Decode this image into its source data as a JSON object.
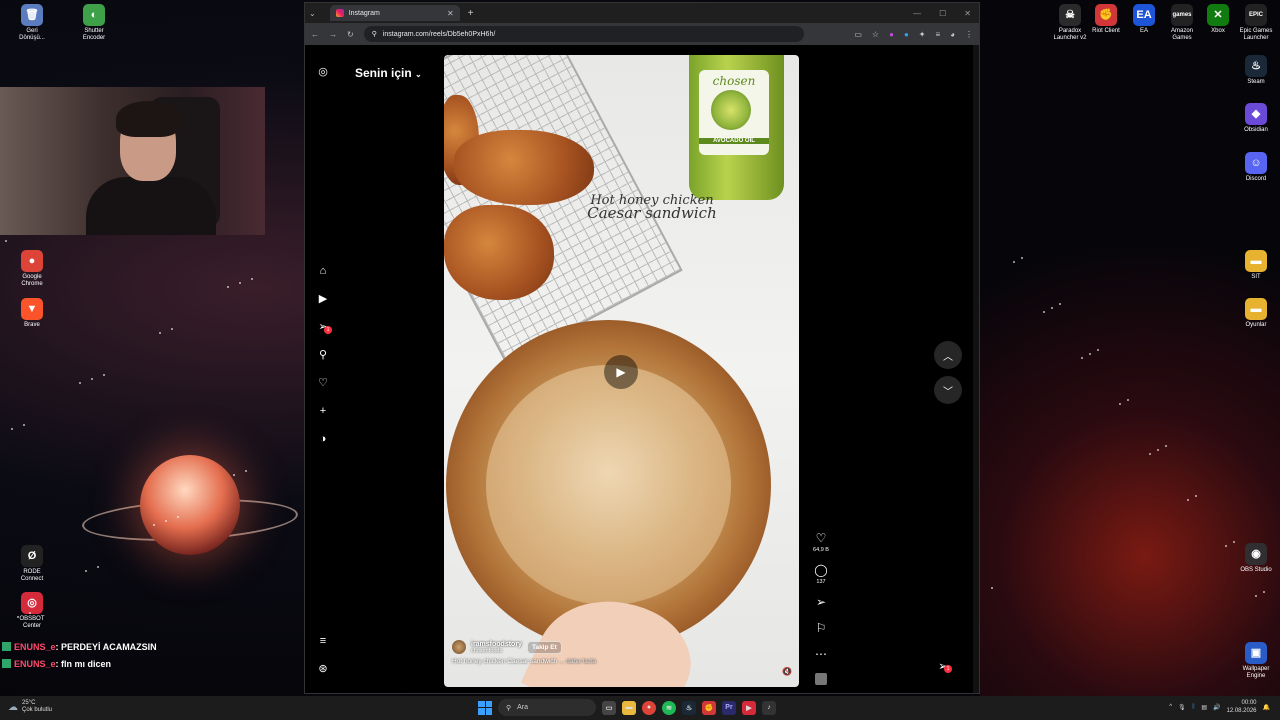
{
  "desktop_left": {
    "icons": [
      {
        "label": "Geri\nDönüşü...",
        "glyph": "🗑",
        "color": "#5b7dbf"
      },
      {
        "label": "Shutter\nEncoder",
        "glyph": "◐",
        "color": "#3fa04a"
      },
      {
        "label": "Google\nChrome",
        "glyph": "●",
        "color": "#db4437"
      },
      {
        "label": "Brave",
        "glyph": "▼",
        "color": "#fb542b"
      },
      {
        "label": "RODE\nConnect",
        "glyph": "Ø",
        "color": "#222"
      },
      {
        "label": "OBSBOT\nCenter",
        "glyph": "◎",
        "color": "#d42a3a"
      }
    ]
  },
  "desktop_right": {
    "icons": [
      {
        "label": "Paradox\nLauncher v2",
        "glyph": "☠",
        "color": "#2a2a2a"
      },
      {
        "label": "Riot Client",
        "glyph": "✊",
        "color": "#d13639"
      },
      {
        "label": "EA",
        "glyph": "EA",
        "color": "#1e55d8"
      },
      {
        "label": "Amazon\nGames",
        "glyph": "games",
        "color": "#222"
      },
      {
        "label": "Xbox",
        "glyph": "✕",
        "color": "#107c10"
      },
      {
        "label": "Epic Games\nLauncher",
        "glyph": "EPIC",
        "color": "#222"
      },
      {
        "label": "Steam",
        "glyph": "♨",
        "color": "#1b2838"
      },
      {
        "label": "Obsidian",
        "glyph": "◆",
        "color": "#6c4ad8"
      },
      {
        "label": "Discord",
        "glyph": "☺",
        "color": "#5865f2"
      },
      {
        "label": "SIT",
        "glyph": "▬",
        "color": "#e6b230"
      },
      {
        "label": "Oyunlar",
        "glyph": "▬",
        "color": "#e6b230"
      },
      {
        "label": "OBS Studio",
        "glyph": "◉",
        "color": "#302e31"
      },
      {
        "label": "Wallpaper\nEngine",
        "glyph": "▣",
        "color": "#2a5cc8"
      }
    ]
  },
  "chat": [
    {
      "user": "ENUNS_e",
      "message": ": PERDEYİ ACAMAZSIN"
    },
    {
      "user": "ENUNS_e",
      "message": ": fln mı dicen"
    }
  ],
  "browser": {
    "tab_title": "Instagram",
    "url": "instagram.com/reels/Db5eh0PxH6h/"
  },
  "instagram": {
    "feed_title": "Senin için",
    "overlay_title_line1": "Hot honey chicken",
    "overlay_title_line2": "Caesar sandwich",
    "account_name": "iramsfoodstory",
    "collab_name": "chosenfoods",
    "follow_label": "Takip Et",
    "caption": "Hot honey chicken Caesar sandwich",
    "caption_more": "... daha fazla",
    "likes": "64,9 B",
    "comments": "137",
    "dm_badge": "1",
    "bottle_brand": "chosen",
    "bottle_product": "AVOCADO OIL"
  },
  "taskbar": {
    "temperature": "25°C",
    "weather": "Çok bulutlu",
    "search_placeholder": "Ara",
    "time": "00:00",
    "date": "12.08.2026"
  }
}
